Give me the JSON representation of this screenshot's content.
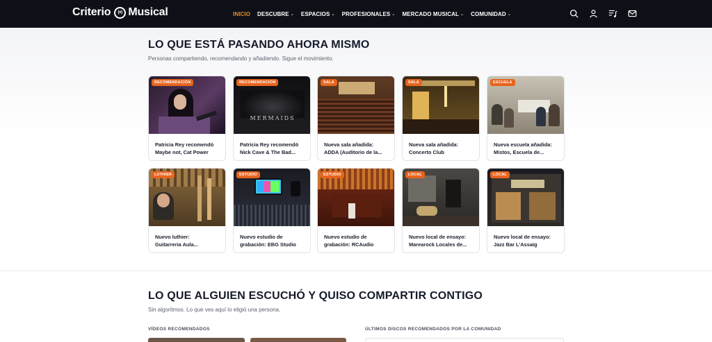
{
  "header": {
    "logo_left": "Criterio",
    "logo_mark": "(e)",
    "logo_right": "Musical",
    "nav": [
      {
        "label": "INICIO",
        "active": true,
        "dropdown": false
      },
      {
        "label": "DESCUBRE",
        "active": false,
        "dropdown": true
      },
      {
        "label": "ESPACIOS",
        "active": false,
        "dropdown": true
      },
      {
        "label": "PROFESIONALES",
        "active": false,
        "dropdown": true
      },
      {
        "label": "MERCADO MUSICAL",
        "active": false,
        "dropdown": true
      },
      {
        "label": "COMUNIDAD",
        "active": false,
        "dropdown": true
      }
    ],
    "tools": [
      "search-icon",
      "user-icon",
      "playlist-icon",
      "mail-icon"
    ]
  },
  "now": {
    "title": "LO QUE ESTÁ PASANDO AHORA MISMO",
    "subtitle": "Personas compartiendo, recomendando y añadiendo. Sigue el movimiento.",
    "cards": [
      {
        "tag": "RECOMENDACIÓN",
        "line1": "Patricia Rey recomendó",
        "line2": "Maybe not, Cat Power",
        "image": "singer-performing"
      },
      {
        "tag": "RECOMENDACIÓN",
        "line1": "Patricia Rey recomendó",
        "line2": "Nick Cave & The Bad...",
        "image": "mermaids-cover",
        "image_text": "MERMAIDS"
      },
      {
        "tag": "SALA",
        "line1": "Nueva sala añadida:",
        "line2": "ADDA (Auditorio de la...",
        "image": "auditorium"
      },
      {
        "tag": "SALA",
        "line1": "Nueva sala añadida:",
        "line2": "Concerto Club",
        "image": "club-interior"
      },
      {
        "tag": "ESCUELA",
        "line1": "Nueva escuela añadida:",
        "line2": "Mistos, Escuela de...",
        "image": "classroom"
      },
      {
        "tag": "LUTHIER",
        "line1": "Nuevo luthier:",
        "line2": "Guitarreria Aula...",
        "image": "luthier-workshop"
      },
      {
        "tag": "ESTUDIO",
        "line1": "Nuevo estudio de",
        "line2": "grabación: EBG Studio",
        "image": "recording-desk"
      },
      {
        "tag": "ESTUDIO",
        "line1": "Nuevo estudio de",
        "line2": "grabación: RCAudio",
        "image": "theater-stage"
      },
      {
        "tag": "LOCAL",
        "line1": "Nuevo local de ensayo:",
        "line2": "Marearock Locales de...",
        "image": "rehearsal-room"
      },
      {
        "tag": "LOCAL",
        "line1": "Nuevo local de ensayo:",
        "line2": "Jazz Bar L'Assaig",
        "image": "bar-front"
      }
    ]
  },
  "shared": {
    "title": "LO QUE ALGUIEN ESCUCHÓ Y QUISO COMPARTIR CONTIGO",
    "subtitle": "Sin algoritmos. Lo que ves aquí lo eligió una persona.",
    "videos_label": "VÍDEOS RECOMENDADOS",
    "discs_label": "ÚLTIMOS DISCOS RECOMENDADOS POR LA COMUNIDAD"
  },
  "colors": {
    "accent": "#f08a24",
    "tag": "#e8641e",
    "header_bg": "#0d1117"
  }
}
